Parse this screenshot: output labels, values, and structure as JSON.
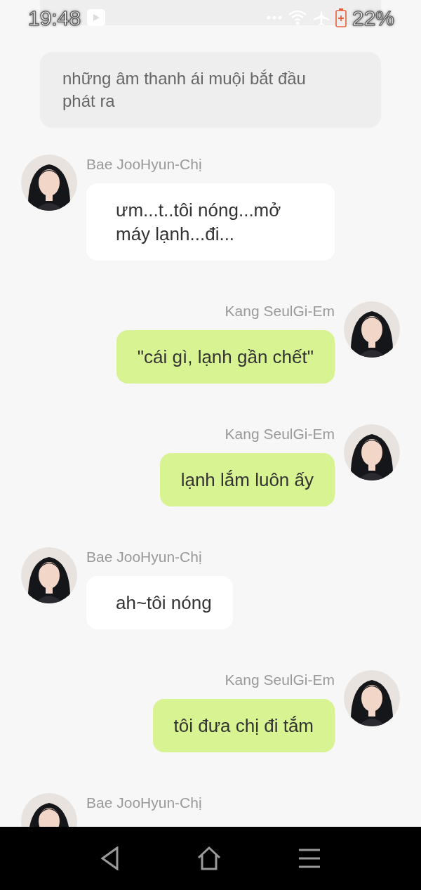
{
  "status_bar": {
    "time": "19:48",
    "battery": "22%"
  },
  "messages": [
    {
      "kind": "narration"
    },
    {
      "kind": "narration",
      "text": "những âm thanh ái muội bắt đầu phát ra"
    },
    {
      "kind": "received",
      "sender": "Bae JooHyun-Chị",
      "text": "ưm...t..tôi nóng...mở máy lạnh...đi..."
    },
    {
      "kind": "sent",
      "sender": "Kang SeulGi-Em",
      "text": "\"cái gì, lạnh gần chết\""
    },
    {
      "kind": "sent",
      "sender": "Kang SeulGi-Em",
      "text": "lạnh lắm luôn ấy"
    },
    {
      "kind": "received",
      "sender": "Bae JooHyun-Chị",
      "text": "ah~tôi nóng"
    },
    {
      "kind": "sent",
      "sender": "Kang SeulGi-Em",
      "text": "tôi đưa chị đi tắm"
    },
    {
      "kind": "received",
      "sender": "Bae JooHyun-Chị"
    }
  ]
}
